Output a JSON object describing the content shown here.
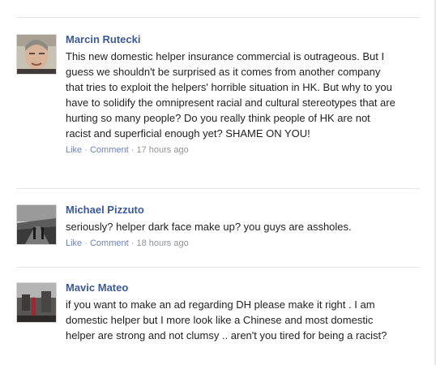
{
  "comments": [
    {
      "author": "Marcin Rutecki",
      "avatar_icon": "user-avatar-photo-portrait",
      "text": "This new domestic helper insurance commercial is outrageous. But I guess we shouldn't be surprised as it comes from another company that tries to exploit the helpers' horrible situation in HK. But why to you have to solidify the omnipresent racial and cultural stereotypes that are hurting so many people? Do you really think people of HK are not racist and superficial enough yet? SHAME ON YOU!",
      "like_label": "Like",
      "comment_label": "Comment",
      "separator": "·",
      "time": "17 hours ago"
    },
    {
      "author": "Michael Pizzuto",
      "avatar_icon": "user-avatar-photo-road",
      "text": "seriously? helper dark face make up? you guys are assholes.",
      "like_label": "Like",
      "comment_label": "Comment",
      "separator": "·",
      "time": "18 hours ago"
    },
    {
      "author": "Mavic Mateo",
      "avatar_icon": "user-avatar-photo-street",
      "text": "if you want to make an ad regarding DH please make it right . I am domestic helper but I more look like a Chinese and most domestic helper are strong and not clumsy .. aren't you tired for being a racist?",
      "like_label": "",
      "comment_label": "",
      "separator": "",
      "time": ""
    }
  ],
  "colors": {
    "author": "#3b5998",
    "link": "#6d84b4",
    "meta": "#90949c",
    "text": "#222222",
    "divider": "#e5e6e9"
  }
}
